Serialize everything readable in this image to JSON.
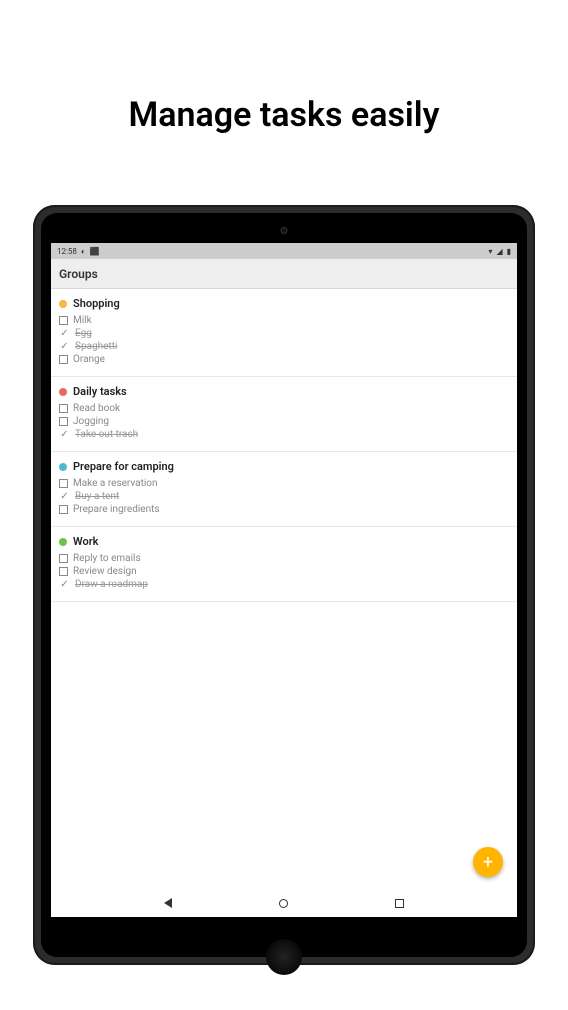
{
  "headline": "Manage tasks easily",
  "status_bar": {
    "time": "12:58",
    "icons_left": [
      "◐",
      "⬛"
    ],
    "icons_right": [
      "▾",
      "◢",
      "▮"
    ]
  },
  "app_header": {
    "title": "Groups"
  },
  "groups": [
    {
      "name": "Shopping",
      "color": "#f5b942",
      "tasks": [
        {
          "label": "Milk",
          "done": false
        },
        {
          "label": "Egg",
          "done": true
        },
        {
          "label": "Spaghetti",
          "done": true
        },
        {
          "label": "Orange",
          "done": false
        }
      ]
    },
    {
      "name": "Daily tasks",
      "color": "#e96b5b",
      "tasks": [
        {
          "label": "Read book",
          "done": false
        },
        {
          "label": "Jogging",
          "done": false
        },
        {
          "label": "Take out trash",
          "done": true
        }
      ]
    },
    {
      "name": "Prepare for camping",
      "color": "#4fb8d6",
      "tasks": [
        {
          "label": "Make a reservation",
          "done": false
        },
        {
          "label": "Buy a tent",
          "done": true
        },
        {
          "label": "Prepare ingredients",
          "done": false
        }
      ]
    },
    {
      "name": "Work",
      "color": "#6cc24a",
      "tasks": [
        {
          "label": "Reply to emails",
          "done": false
        },
        {
          "label": "Review design",
          "done": false
        },
        {
          "label": "Draw a roadmap",
          "done": true
        }
      ]
    }
  ],
  "fab": {
    "label": "+"
  }
}
